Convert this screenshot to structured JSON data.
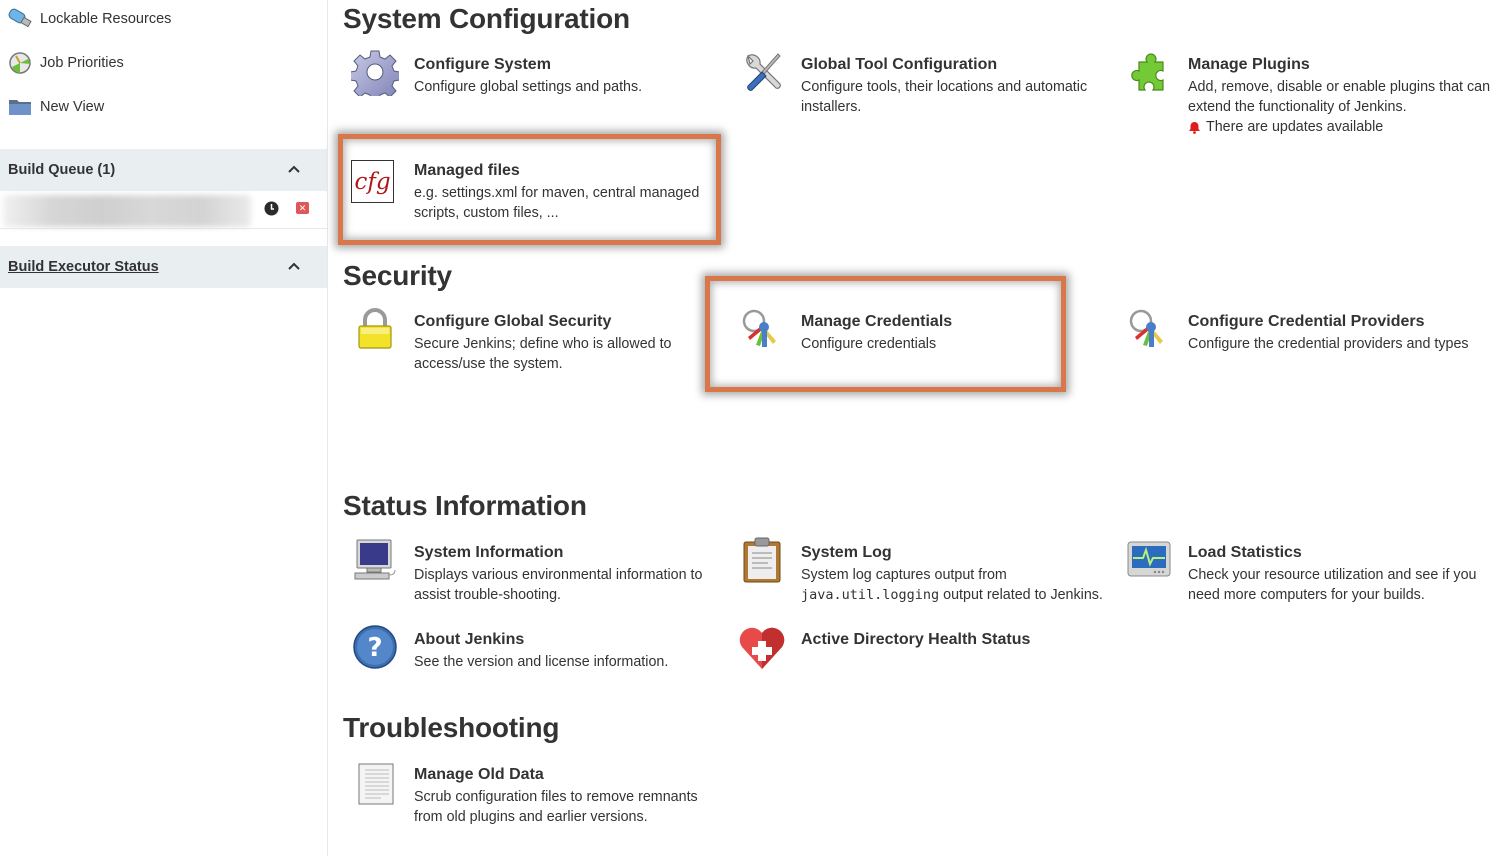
{
  "sidebar": {
    "items": [
      {
        "label": "Lockable Resources",
        "icon": "usb-drive-icon"
      },
      {
        "label": "Job Priorities",
        "icon": "priority-gauge-icon"
      },
      {
        "label": "New View",
        "icon": "folder-icon"
      }
    ],
    "build_queue": {
      "title": "Build Queue (1)",
      "items": [
        {
          "name": "",
          "status_icon": "clock-icon",
          "action_icon": "cancel-icon"
        }
      ]
    },
    "build_executor": {
      "title": "Build Executor Status"
    }
  },
  "sections": {
    "system_configuration": {
      "title": "System Configuration",
      "items": [
        {
          "name": "Configure System",
          "desc": "Configure global settings and paths.",
          "icon": "gear-icon"
        },
        {
          "name": "Global Tool Configuration",
          "desc": "Configure tools, their locations and automatic installers.",
          "icon": "tools-icon"
        },
        {
          "name": "Manage Plugins",
          "desc": "Add, remove, disable or enable plugins that can extend the functionality of Jenkins.",
          "note": "There are updates available",
          "icon": "puzzle-piece-icon"
        },
        {
          "name": "Managed files",
          "desc": "e.g. settings.xml for maven, central managed scripts, custom files, ...",
          "icon": "cfg-file-icon"
        }
      ]
    },
    "security": {
      "title": "Security",
      "items": [
        {
          "name": "Configure Global Security",
          "desc": "Secure Jenkins; define who is allowed to access/use the system.",
          "icon": "padlock-icon"
        },
        {
          "name": "Manage Credentials",
          "desc": "Configure credentials",
          "icon": "keys-icon"
        },
        {
          "name": "Configure Credential Providers",
          "desc": "Configure the credential providers and types",
          "icon": "keys-icon"
        }
      ]
    },
    "status_information": {
      "title": "Status Information",
      "items": [
        {
          "name": "System Information",
          "desc": "Displays various environmental information to assist trouble-shooting.",
          "icon": "computer-icon"
        },
        {
          "name": "System Log",
          "desc_code": "java.util.logging",
          "desc_pre": "System log captures output from",
          "desc_post": "output related to Jenkins.",
          "icon": "clipboard-icon"
        },
        {
          "name": "Load Statistics",
          "desc": "Check your resource utilization and see if you need more computers for your builds.",
          "icon": "monitor-pulse-icon"
        },
        {
          "name": "About Jenkins",
          "desc": "See the version and license information.",
          "icon": "help-icon"
        },
        {
          "name": "Active Directory Health Status",
          "icon": "heart-plus-icon"
        }
      ]
    },
    "troubleshooting": {
      "title": "Troubleshooting",
      "items": [
        {
          "name": "Manage Old Data",
          "desc": "Scrub configuration files to remove remnants from old plugins and earlier versions.",
          "icon": "document-icon"
        }
      ]
    }
  },
  "annotations": {
    "highlight_color": "#d8774a",
    "highlighted": [
      "Managed files",
      "Manage Credentials"
    ]
  }
}
